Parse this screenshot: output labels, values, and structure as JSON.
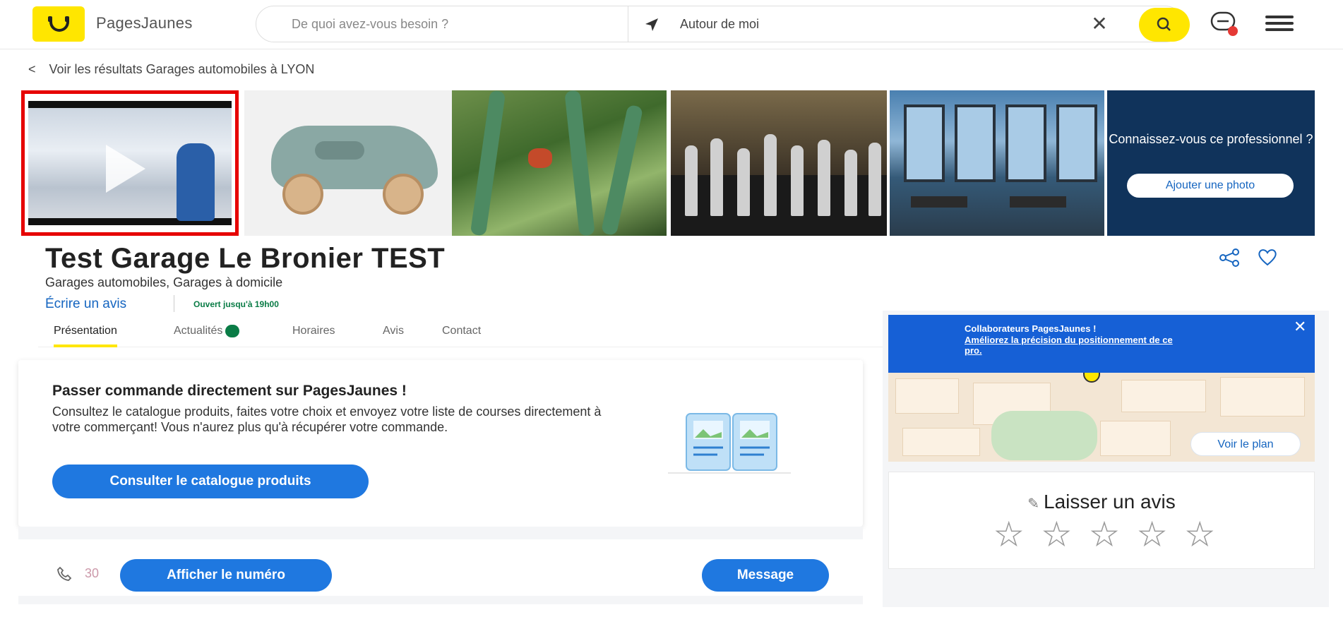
{
  "header": {
    "brand": "PagesJaunes",
    "search_what_placeholder": "De quoi avez-vous besoin ?",
    "search_where_value": "Autour de moi",
    "chat_badge": "0"
  },
  "breadcrumb": {
    "chevron": "<",
    "label": "Voir les résultats Garages automobiles à LYON"
  },
  "gallery": {
    "cta_text": "Connaissez-vous ce professionnel ?",
    "cta_button": "Ajouter une photo"
  },
  "business": {
    "name": "Test Garage Le Bronier TEST",
    "categories": "Garages automobiles, Garages à domicile",
    "write_review": "Écrire un avis",
    "open_status": "Ouvert jusqu'à 19h00"
  },
  "tabs": [
    {
      "label": "Présentation",
      "active": true
    },
    {
      "label": "Actualités",
      "badge": true
    },
    {
      "label": "Horaires"
    },
    {
      "label": "Avis"
    },
    {
      "label": "Contact"
    }
  ],
  "order_card": {
    "title": "Passer commande directement sur PagesJaunes !",
    "text": "Consultez le catalogue produits, faites votre choix et envoyez votre liste de courses directement à votre commerçant! Vous n'aurez plus qu'à récupérer votre commande.",
    "button": "Consulter le catalogue produits"
  },
  "contact_card": {
    "phone_partial": "30",
    "show_number_button": "Afficher le numéro",
    "message_button": "Message"
  },
  "map": {
    "banner_title": "Collaborateurs PagesJaunes !",
    "banner_link": "Améliorez la précision du positionnement de ce pro.",
    "see_map_button": "Voir le plan"
  },
  "review": {
    "title": "Laisser un avis",
    "star_count": 5
  },
  "colors": {
    "brand_yellow": "#ffe600",
    "primary_blue": "#1f78e0",
    "highlight_red": "#e60000",
    "open_green": "#0a7c46"
  }
}
